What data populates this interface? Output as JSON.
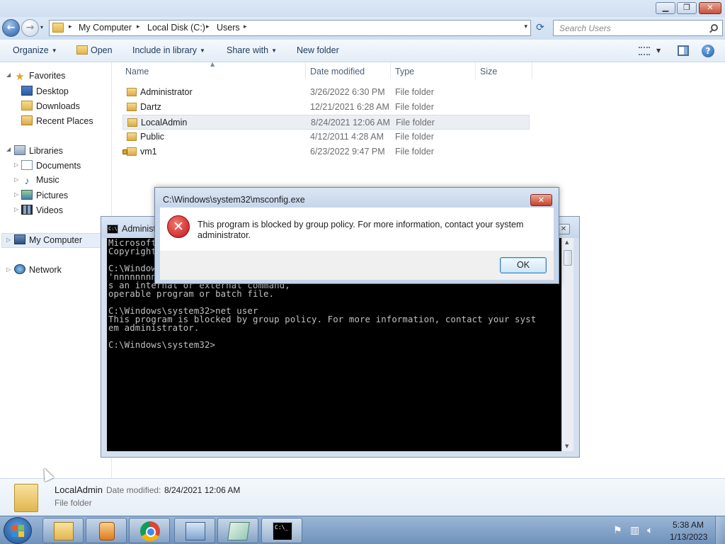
{
  "window": {
    "controls": {
      "minimize": "▁",
      "maximize": "❐",
      "close": "✕"
    }
  },
  "address": {
    "crumbs": [
      "My Computer",
      "Local Disk (C:)",
      "Users"
    ],
    "separator": "▸",
    "dropdown": "▾",
    "refresh": "⟳",
    "back": "←",
    "forward": "→",
    "recent": "▾"
  },
  "search": {
    "placeholder": "Search Users"
  },
  "toolbar": {
    "organize": "Organize",
    "open": "Open",
    "include_in_library": "Include in library",
    "share_with": "Share with",
    "new_folder": "New folder",
    "help": "?"
  },
  "nav": {
    "favorites": {
      "label": "Favorites",
      "items": [
        "Desktop",
        "Downloads",
        "Recent Places"
      ]
    },
    "libraries": {
      "label": "Libraries",
      "items": [
        "Documents",
        "Music",
        "Pictures",
        "Videos"
      ]
    },
    "computer": "My Computer",
    "network": "Network"
  },
  "filelist": {
    "columns": {
      "name": "Name",
      "date_modified": "Date modified",
      "type": "Type",
      "size": "Size"
    },
    "rows": [
      {
        "name": "Administrator",
        "date": "3/26/2022 6:30 PM",
        "type": "File folder",
        "selected": false,
        "locked": false
      },
      {
        "name": "Dartz",
        "date": "12/21/2021 6:28 AM",
        "type": "File folder",
        "selected": false,
        "locked": false
      },
      {
        "name": "LocalAdmin",
        "date": "8/24/2021 12:06 AM",
        "type": "File folder",
        "selected": true,
        "locked": false
      },
      {
        "name": "Public",
        "date": "4/12/2011 4:28 AM",
        "type": "File folder",
        "selected": false,
        "locked": false
      },
      {
        "name": "vm1",
        "date": "6/23/2022 9:47 PM",
        "type": "File folder",
        "selected": false,
        "locked": true
      }
    ]
  },
  "details": {
    "name": "LocalAdmin",
    "date_label": "Date modified:",
    "date_value": "8/24/2021 12:06 AM",
    "type": "File folder"
  },
  "cmd": {
    "title": "Administ",
    "icon_text": "C:\\.",
    "output": "Microsoft\nCopyright\n\nC:\\Windows\n'nnnnnnnnn\ns an internal or external command,\noperable program or batch file.\n\nC:\\Windows\\system32>net user\nThis program is blocked by group policy. For more information, contact your syst\nem administrator.\n\nC:\\Windows\\system32>"
  },
  "dialog": {
    "title": "C:\\Windows\\system32\\msconfig.exe",
    "message": "This program is blocked by group policy. For more information, contact your system administrator.",
    "ok": "OK",
    "close": "✕",
    "error_glyph": "✕"
  },
  "taskbar": {
    "cmd_icon_text": "C:\\_",
    "clock_time": "5:38 AM",
    "clock_date": "1/13/2023",
    "tray_icons": [
      "flag-icon",
      "network-icon",
      "volume-icon"
    ]
  }
}
